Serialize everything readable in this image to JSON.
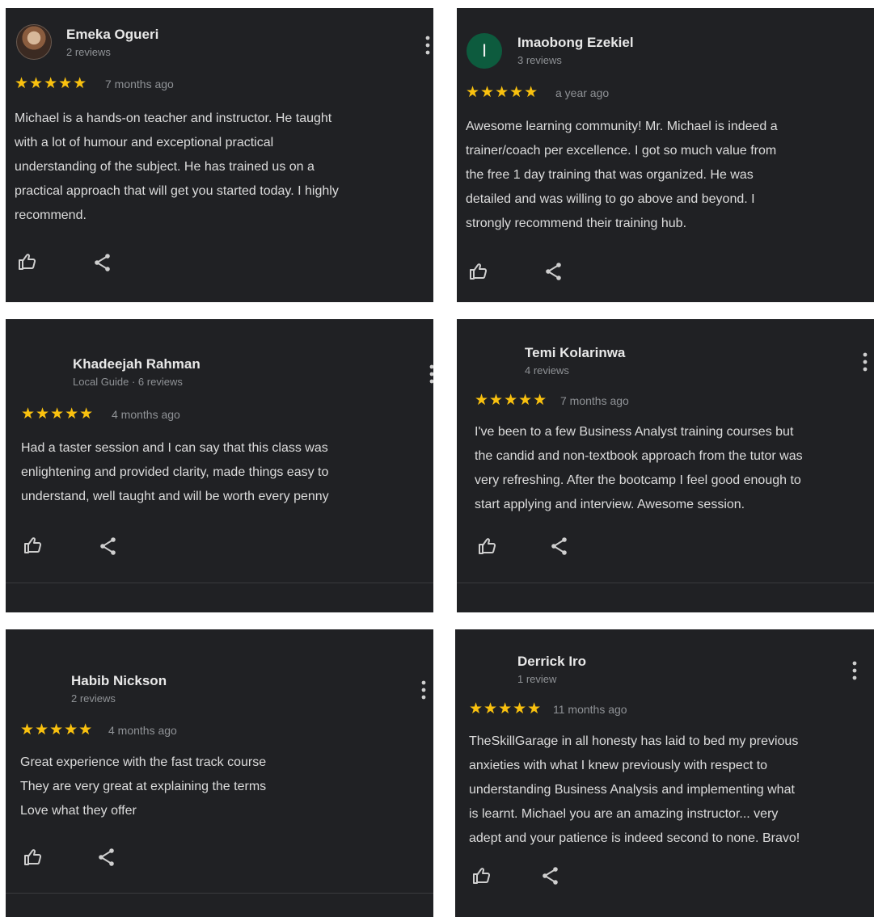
{
  "reviews": [
    {
      "name": "Emeka Ogueri",
      "meta": "2 reviews",
      "stars": "★★★★★",
      "ago": "7 months ago",
      "text": "Michael is a hands-on teacher and instructor. He taught\nwith a lot of humour and exceptional practical\nunderstanding of the subject. He has trained us on a\npractical approach that will get you started today. I highly\nrecommend."
    },
    {
      "name": "Imaobong Ezekiel",
      "initial": "I",
      "meta": "3 reviews",
      "stars": "★★★★★",
      "ago": "a year ago",
      "text": "Awesome learning community! Mr. Michael is indeed a\ntrainer/coach per excellence. I got so much value from\nthe free 1 day training that was organized. He was\ndetailed and was willing to go above and beyond. I\nstrongly recommend their training hub."
    },
    {
      "name": "Khadeejah Rahman",
      "meta": "Local Guide · 6 reviews",
      "stars": "★★★★★",
      "ago": "4 months ago",
      "text": "Had a taster session and I can say that this class was\nenlightening and provided clarity, made things easy to\nunderstand, well taught and will be worth every penny"
    },
    {
      "name": "Temi Kolarinwa",
      "meta": "4 reviews",
      "stars": "★★★★★",
      "ago": "7 months ago",
      "text": "I've been to a few Business Analyst training courses but\nthe candid and non-textbook approach from the tutor was\nvery refreshing. After the bootcamp I feel good enough to\nstart applying and interview. Awesome session."
    },
    {
      "name": "Habib Nickson",
      "meta": "2 reviews",
      "stars": "★★★★★",
      "ago": "4 months ago",
      "text": "Great experience with the fast track course\nThey are very great at explaining the terms\nLove what they offer"
    },
    {
      "name": "Derrick Iro",
      "meta": "1 review",
      "stars": "★★★★★",
      "ago": "11 months ago",
      "text": "TheSkillGarage in all honesty has laid to bed my previous\nanxieties with what I knew previously with respect to\nunderstanding Business Analysis and implementing what\nis learnt. Michael you are an amazing instructor... very\nadept and your patience is indeed second to none. Bravo!"
    }
  ],
  "colors": {
    "card_bg": "#202124",
    "star": "#f9c10f",
    "meta": "#8f9296",
    "initial_avatar": "#0d5b3e"
  },
  "icons": {
    "like": "thumbs-up-icon",
    "share": "share-icon",
    "more": "more-vert-icon"
  }
}
